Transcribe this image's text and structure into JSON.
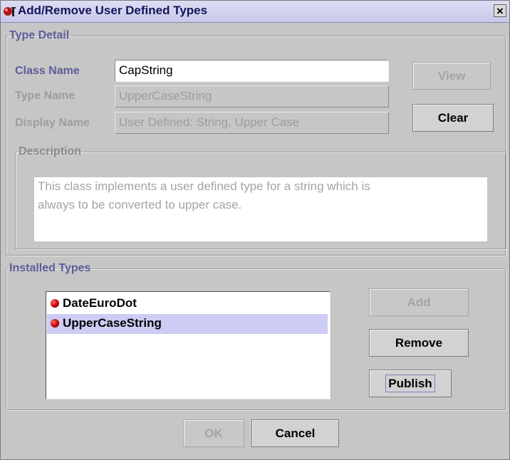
{
  "window": {
    "title": "Add/Remove User Defined Types",
    "close_symbol": "×",
    "icon": "app-logo-icon"
  },
  "type_detail": {
    "legend": "Type Detail",
    "class_name": {
      "label": "Class Name",
      "value": "CapString"
    },
    "type_name": {
      "label": "Type Name",
      "value": "UpperCaseString"
    },
    "display_name": {
      "label": "Display Name",
      "value": "User Defined: String,  Upper Case"
    },
    "view_button": "View",
    "clear_button": "Clear",
    "description": {
      "legend": "Description",
      "line1": "This class implements a user defined type for a string which is",
      "line2": "always to be converted to upper case."
    }
  },
  "installed_types": {
    "legend": "Installed Types",
    "items": [
      {
        "label": "DateEuroDot",
        "selected": false
      },
      {
        "label": "UpperCaseString",
        "selected": true
      }
    ],
    "add_button": "Add",
    "remove_button": "Remove",
    "publish_button": "Publish"
  },
  "footer": {
    "ok_button": "OK",
    "cancel_button": "Cancel"
  },
  "colors": {
    "dialog_bg": "#c6c6c6",
    "accent_label": "#5c5c9a",
    "selection": "#ccccf4",
    "disabled_text": "#9d9d9d"
  }
}
